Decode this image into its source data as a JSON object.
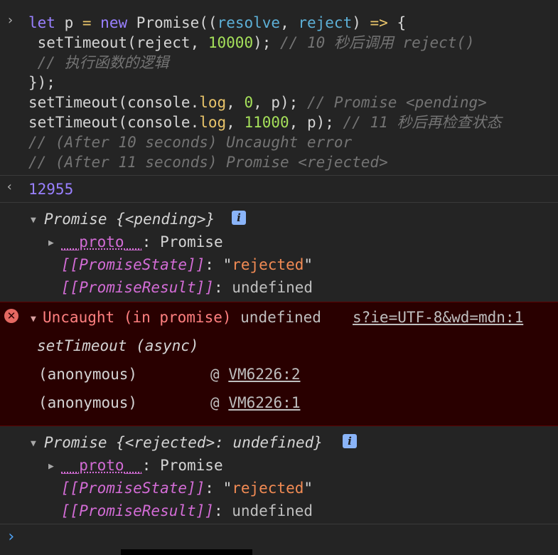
{
  "code": {
    "l1_let": "let",
    "l1_p": " p ",
    "l1_eq": "=",
    "l1_new": " new",
    "l1_Promise": " Promise((",
    "l1_resolve": "resolve",
    "l1_comma": ", ",
    "l1_reject": "reject",
    "l1_close": ") ",
    "l1_arrow": "=>",
    "l1_brace": " {",
    "l2_fn": " setTimeout(reject, ",
    "l2_num": "10000",
    "l2_end": "); ",
    "l2_comment": "// 10 秒后调用 reject()",
    "l3_comment": " // 执行函数的逻辑",
    "l4": "});",
    "l5_a": "setTimeout(console.",
    "l5_log": "log",
    "l5_b": ", ",
    "l5_num": "0",
    "l5_c": ", p); ",
    "l5_comment": "// Promise <pending>",
    "l6_a": "setTimeout(console.",
    "l6_log": "log",
    "l6_b": ", ",
    "l6_num": "11000",
    "l6_c": ", p); ",
    "l6_comment": "// 11 秒后再检查状态",
    "l7_comment": "// (After 10 seconds) Uncaught error",
    "l8_comment": "// (After 11 seconds) Promise <rejected>"
  },
  "return_value": "12955",
  "promise1": {
    "header": "Promise {<pending>}",
    "proto_key": "__proto__",
    "proto_sep": ": ",
    "proto_val": "Promise",
    "state_key": "[[PromiseState]]",
    "state_sep": ": \"",
    "state_val": "rejected",
    "state_end": "\"",
    "result_key": "[[PromiseResult]]",
    "result_sep": ": ",
    "result_val": "undefined"
  },
  "error": {
    "message": "Uncaught (in promise)",
    "value": " undefined",
    "source": "s?ie=UTF-8&wd=mdn:1",
    "frame0": "setTimeout (async)",
    "frame1_name": "(anonymous)",
    "frame1_at": "@",
    "frame1_loc": "VM6226:2",
    "frame2_name": "(anonymous)",
    "frame2_at": "@",
    "frame2_loc": "VM6226:1"
  },
  "promise2": {
    "header": "Promise {<rejected>: undefined}",
    "proto_key": "__proto__",
    "proto_sep": ": ",
    "proto_val": "Promise",
    "state_key": "[[PromiseState]]",
    "state_sep": ": \"",
    "state_val": "rejected",
    "state_end": "\"",
    "result_key": "[[PromiseResult]]",
    "result_sep": ": ",
    "result_val": "undefined"
  },
  "icons": {
    "input_chevron": "›",
    "return_chevron": "‹",
    "prompt_chevron": "›",
    "expand": "▼",
    "collapse": "▶",
    "info": "i",
    "error": "✕"
  }
}
